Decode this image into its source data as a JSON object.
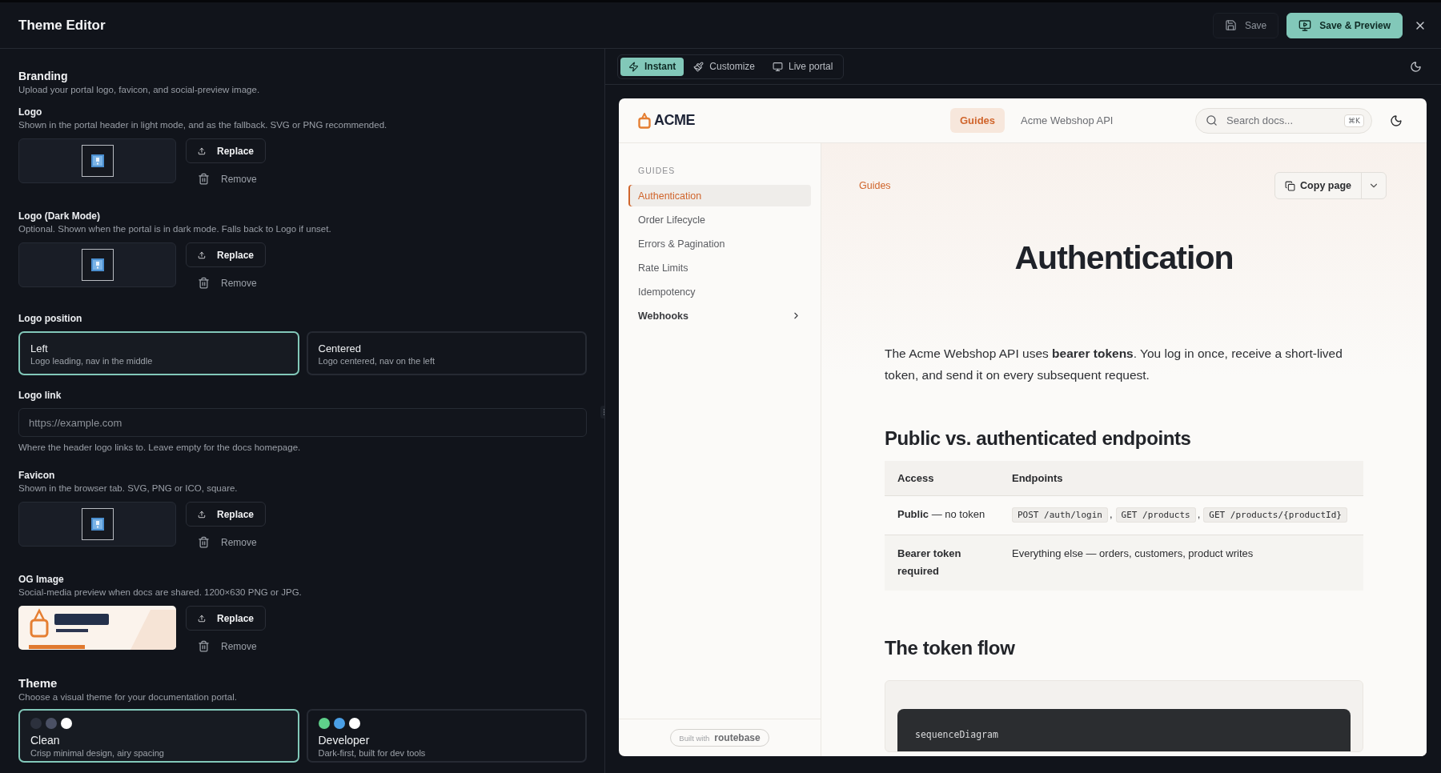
{
  "window": {
    "title": "Theme Editor"
  },
  "header_actions": [
    {
      "kind": "ghost",
      "label": "Save"
    },
    {
      "kind": "primary",
      "label": "Save & Preview"
    }
  ],
  "branding": {
    "title": "Branding",
    "description": "Upload your portal logo, favicon, and social-preview image."
  },
  "fields": [
    {
      "kind": "upload",
      "label": "Logo",
      "description": "Shown in the portal header in light mode, and as the fallback. SVG or PNG recommended.",
      "preview": {
        "kind": "placeholder"
      },
      "replace": "Replace",
      "remove": "Remove"
    },
    {
      "kind": "upload",
      "label": "Logo (Dark Mode)",
      "description": "Optional. Shown when the portal is in dark mode. Falls back to Logo if unset.",
      "preview": {
        "kind": "placeholder"
      },
      "replace": "Replace",
      "remove": "Remove"
    },
    {
      "kind": "choice",
      "label": "Logo position",
      "options": [
        {
          "title": "Left",
          "description": "Logo leading, nav in the middle",
          "selected": true
        },
        {
          "title": "Centered",
          "description": "Logo centered, nav on the left",
          "selected": false
        }
      ]
    },
    {
      "kind": "input",
      "label": "Logo link",
      "placeholder": "https://example.com",
      "help": "Where the header logo links to. Leave empty for the docs homepage."
    },
    {
      "kind": "upload",
      "label": "Favicon",
      "description": "Shown in the browser tab. SVG, PNG or ICO, square.",
      "preview": {
        "kind": "placeholder"
      },
      "replace": "Replace",
      "remove": "Remove"
    },
    {
      "kind": "upload",
      "label": "OG Image",
      "description": "Social-media preview when docs are shared. 1200×630 PNG or JPG.",
      "replace": "Replace",
      "remove": "Remove"
    }
  ],
  "theme": {
    "title": "Theme",
    "description": "Choose a visual theme for your documentation portal.",
    "options": [
      {
        "name": "Clean",
        "description": "Crisp minimal design, airy spacing",
        "selected": true,
        "swatches": [
          {
            "color": "#2c313d"
          },
          {
            "color": "#4a5064"
          },
          {
            "color": "#ffffff"
          }
        ]
      },
      {
        "name": "Developer",
        "description": "Dark-first, built for dev tools",
        "selected": false,
        "swatches": [
          {
            "color": "#5fd08a"
          },
          {
            "color": "#4a9fe6"
          },
          {
            "color": "#ffffff"
          }
        ]
      }
    ]
  },
  "preview_tabs": [
    {
      "label": "Instant",
      "selected": true
    },
    {
      "label": "Customize",
      "selected": false
    },
    {
      "label": "Live portal",
      "selected": false
    }
  ],
  "portal": {
    "logo": {
      "name": "ACME"
    },
    "nav": [
      {
        "label": "Guides",
        "selected": true
      },
      {
        "label": "Acme Webshop API",
        "selected": false
      }
    ],
    "search": {
      "placeholder": "Search docs...",
      "shortcut": "⌘K"
    },
    "sidebar": {
      "section": "GUIDES",
      "items": [
        {
          "label": "Authentication",
          "selected": true,
          "expandable": false
        },
        {
          "label": "Order Lifecycle",
          "selected": false,
          "expandable": false
        },
        {
          "label": "Errors & Pagination",
          "selected": false,
          "expandable": false
        },
        {
          "label": "Rate Limits",
          "selected": false,
          "expandable": false
        },
        {
          "label": "Idempotency",
          "selected": false,
          "expandable": false
        },
        {
          "label": "Webhooks",
          "selected": false,
          "expandable": true
        }
      ],
      "footer": {
        "prefix": "Built with",
        "brand": "routebase"
      }
    },
    "content": {
      "breadcrumb": "Guides",
      "copy_button": "Copy page",
      "title": "Authentication",
      "intro": "The Acme Webshop API uses **bearer tokens**. You log in once, receive a short-lived token, and send it on every subsequent request.",
      "table_heading": "Public vs. authenticated endpoints",
      "table": {
        "columns": [
          "Access",
          "Endpoints"
        ],
        "rows": [
          {
            "access": {
              "text": "**Public** — no token",
              "strong": false
            },
            "endpoints": [
              {
                "kind": "code",
                "text": "POST /auth/login"
              },
              {
                "kind": "text",
                "text": ","
              },
              {
                "kind": "code",
                "text": "GET /products"
              },
              {
                "kind": "text",
                "text": ","
              },
              {
                "kind": "code",
                "text": "GET /products/{productId}"
              }
            ]
          },
          {
            "access": {
              "text": "Bearer token required",
              "strong": true
            },
            "endpoints": [
              {
                "kind": "text",
                "text": "Everything else — orders, customers, product writes"
              }
            ]
          }
        ]
      },
      "flow_heading": "The token flow",
      "code": "sequenceDiagram"
    }
  }
}
